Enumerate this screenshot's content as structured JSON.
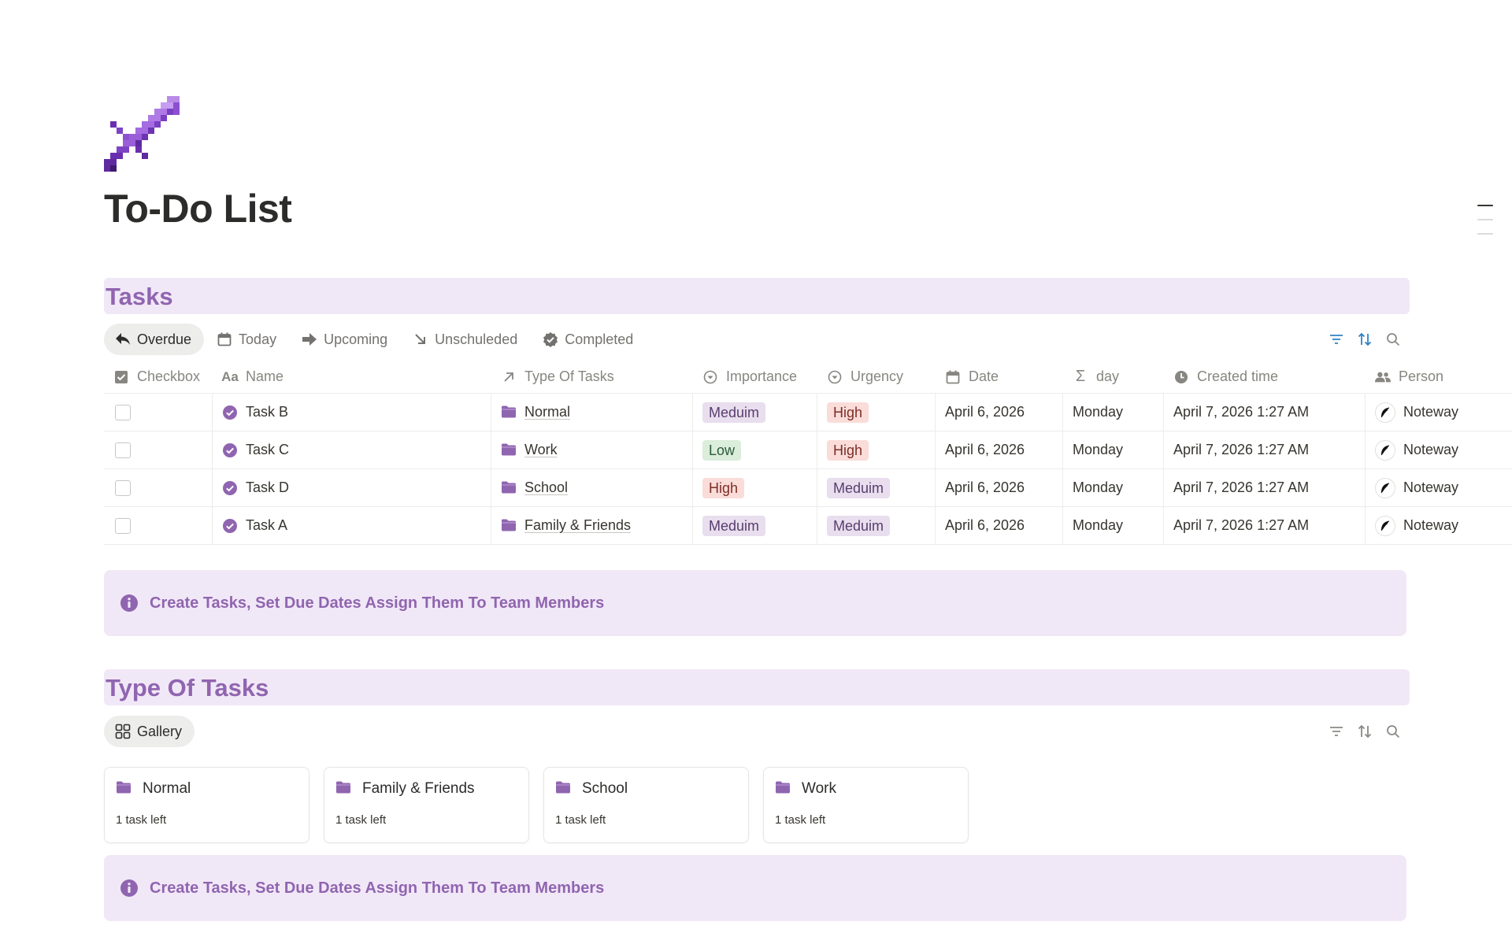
{
  "page": {
    "title": "To-Do List",
    "icon": "pixel-sword-icon"
  },
  "tasks_section": {
    "heading": "Tasks",
    "tabs": [
      {
        "label": "Overdue",
        "icon": "reply-arrow-icon",
        "active": true
      },
      {
        "label": "Today",
        "icon": "calendar-icon",
        "active": false
      },
      {
        "label": "Upcoming",
        "icon": "arrow-right-icon",
        "active": false
      },
      {
        "label": "Unschuleded",
        "icon": "arrow-down-right-icon",
        "active": false
      },
      {
        "label": "Completed",
        "icon": "verified-badge-icon",
        "active": false
      }
    ],
    "columns": {
      "checkbox": "Checkbox",
      "name": "Name",
      "type": "Type Of Tasks",
      "importance": "Importance",
      "urgency": "Urgency",
      "date": "Date",
      "day": "day",
      "created": "Created time",
      "person": "Person"
    },
    "rows": [
      {
        "name": "Task B",
        "type": "Normal",
        "importance": "Meduim",
        "urgency": "High",
        "date": "April 6, 2026",
        "day": "Monday",
        "created": "April 7, 2026 1:27 AM",
        "person": "Noteway"
      },
      {
        "name": "Task C",
        "type": "Work",
        "importance": "Low",
        "urgency": "High",
        "date": "April 6, 2026",
        "day": "Monday",
        "created": "April 7, 2026 1:27 AM",
        "person": "Noteway"
      },
      {
        "name": "Task D",
        "type": "School",
        "importance": "High",
        "urgency": "Meduim",
        "date": "April 6, 2026",
        "day": "Monday",
        "created": "April 7, 2026 1:27 AM",
        "person": "Noteway"
      },
      {
        "name": "Task A",
        "type": "Family & Friends",
        "importance": "Meduim",
        "urgency": "Meduim",
        "date": "April 6, 2026",
        "day": "Monday",
        "created": "April 7, 2026 1:27 AM",
        "person": "Noteway"
      }
    ],
    "callout": "Create Tasks, Set Due Dates Assign Them To Team Members"
  },
  "types_section": {
    "heading": "Type Of Tasks",
    "view_tab": "Gallery",
    "cards": [
      {
        "title": "Normal",
        "subtitle": "1 task left"
      },
      {
        "title": "Family & Friends",
        "subtitle": "1 task left"
      },
      {
        "title": "School",
        "subtitle": "1 task left"
      },
      {
        "title": "Work",
        "subtitle": "1 task left"
      }
    ],
    "callout": "Create Tasks, Set Due Dates Assign Them To Team Members"
  },
  "colors": {
    "accent": "#9065b0",
    "section_bg": "#f1e8f7",
    "pill_purple": "#e8deee",
    "pill_red": "#fadcd9",
    "pill_green": "#dbeddb"
  }
}
